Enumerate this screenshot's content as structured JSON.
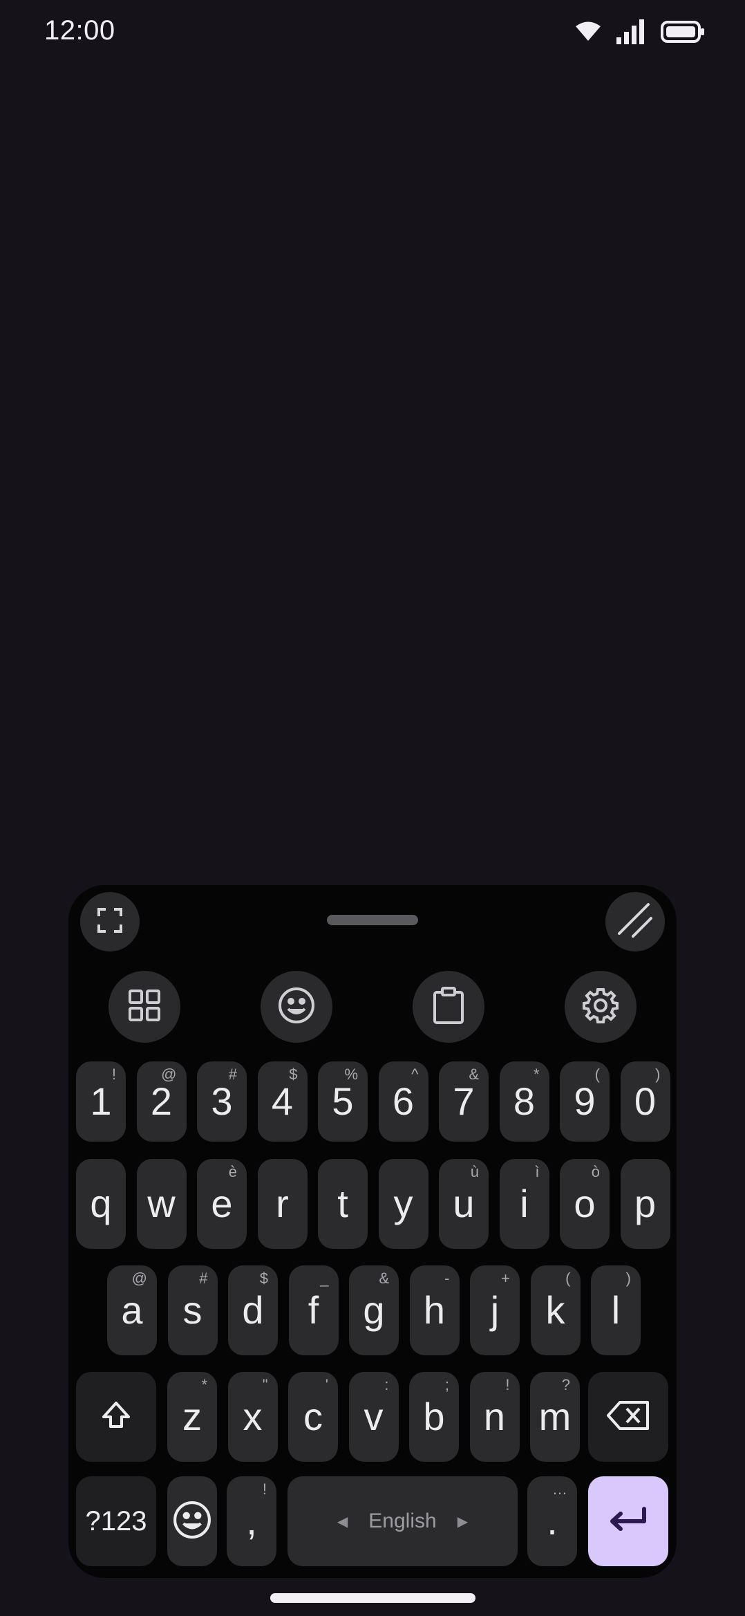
{
  "status_bar": {
    "time": "12:00",
    "icons": [
      "wifi-icon",
      "signal-icon",
      "battery-icon"
    ]
  },
  "keyboard": {
    "top_bar": {
      "left_button": "fullscreen-icon",
      "right_button": "resize-icon"
    },
    "toolbar": [
      "grid-icon",
      "emoji-icon",
      "clipboard-icon",
      "settings-icon"
    ],
    "rows": {
      "numbers": [
        {
          "main": "1",
          "hint": "!"
        },
        {
          "main": "2",
          "hint": "@"
        },
        {
          "main": "3",
          "hint": "#"
        },
        {
          "main": "4",
          "hint": "$"
        },
        {
          "main": "5",
          "hint": "%"
        },
        {
          "main": "6",
          "hint": "^"
        },
        {
          "main": "7",
          "hint": "&"
        },
        {
          "main": "8",
          "hint": "*"
        },
        {
          "main": "9",
          "hint": "("
        },
        {
          "main": "0",
          "hint": ")"
        }
      ],
      "row1": [
        {
          "main": "q",
          "hint": ""
        },
        {
          "main": "w",
          "hint": ""
        },
        {
          "main": "e",
          "hint": "è"
        },
        {
          "main": "r",
          "hint": ""
        },
        {
          "main": "t",
          "hint": ""
        },
        {
          "main": "y",
          "hint": ""
        },
        {
          "main": "u",
          "hint": "ù"
        },
        {
          "main": "i",
          "hint": "ì"
        },
        {
          "main": "o",
          "hint": "ò"
        },
        {
          "main": "p",
          "hint": ""
        }
      ],
      "row2": [
        {
          "main": "a",
          "hint": "@"
        },
        {
          "main": "s",
          "hint": "#"
        },
        {
          "main": "d",
          "hint": "$"
        },
        {
          "main": "f",
          "hint": "_"
        },
        {
          "main": "g",
          "hint": "&"
        },
        {
          "main": "h",
          "hint": "-"
        },
        {
          "main": "j",
          "hint": "+"
        },
        {
          "main": "k",
          "hint": "("
        },
        {
          "main": "l",
          "hint": ")"
        }
      ],
      "row3": [
        {
          "main": "z",
          "hint": "*"
        },
        {
          "main": "x",
          "hint": "\""
        },
        {
          "main": "c",
          "hint": "'"
        },
        {
          "main": "v",
          "hint": ":"
        },
        {
          "main": "b",
          "hint": ";"
        },
        {
          "main": "n",
          "hint": "!"
        },
        {
          "main": "m",
          "hint": "?"
        }
      ]
    },
    "bottom": {
      "symbols_label": "?123",
      "comma": {
        "main": ",",
        "hint": "!"
      },
      "space_label": "English",
      "period": {
        "main": ".",
        "hint": "…"
      }
    },
    "colors": {
      "key": "#2b2b2d",
      "enter": "#d9c8fb",
      "enter_icon": "#2a1a4f"
    }
  }
}
